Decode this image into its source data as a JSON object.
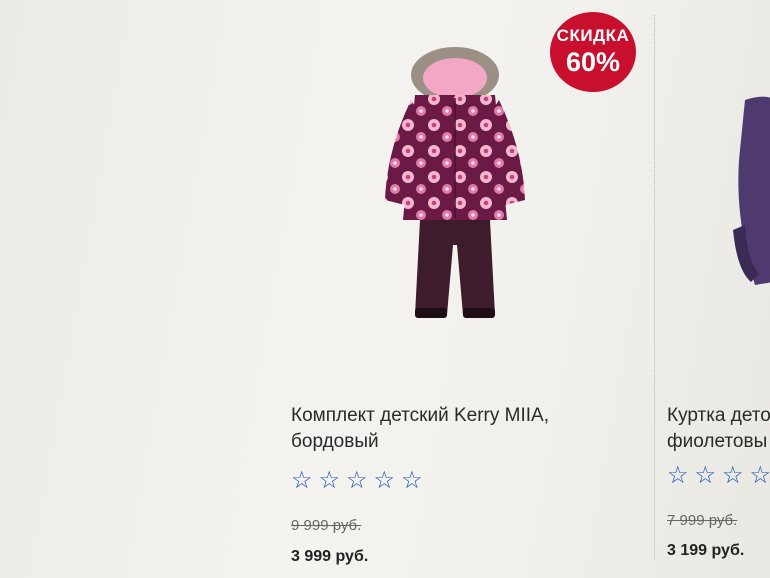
{
  "products": [
    {
      "badge_label": "СКИДКА",
      "badge_value": "60%",
      "title_line1": "Комплект детский Kerry MIIA,",
      "title_line2": "бордовый",
      "rating_stars": 0,
      "rating_max": 5,
      "old_price": "9 999 руб.",
      "new_price": "3 999 руб.",
      "image_icon": "winter-suit-image"
    },
    {
      "title_line1": "Куртка дето",
      "title_line2": "фиолетовы",
      "rating_stars": 0,
      "rating_max": 5,
      "old_price": "7 999 руб.",
      "new_price": "3 199 руб.",
      "image_icon": "purple-jacket-image"
    }
  ],
  "colors": {
    "badge": "#c8102e",
    "star_outline": "#1f56b8",
    "jacket_maroon": "#6a1a45",
    "pants": "#3e1c2c"
  }
}
